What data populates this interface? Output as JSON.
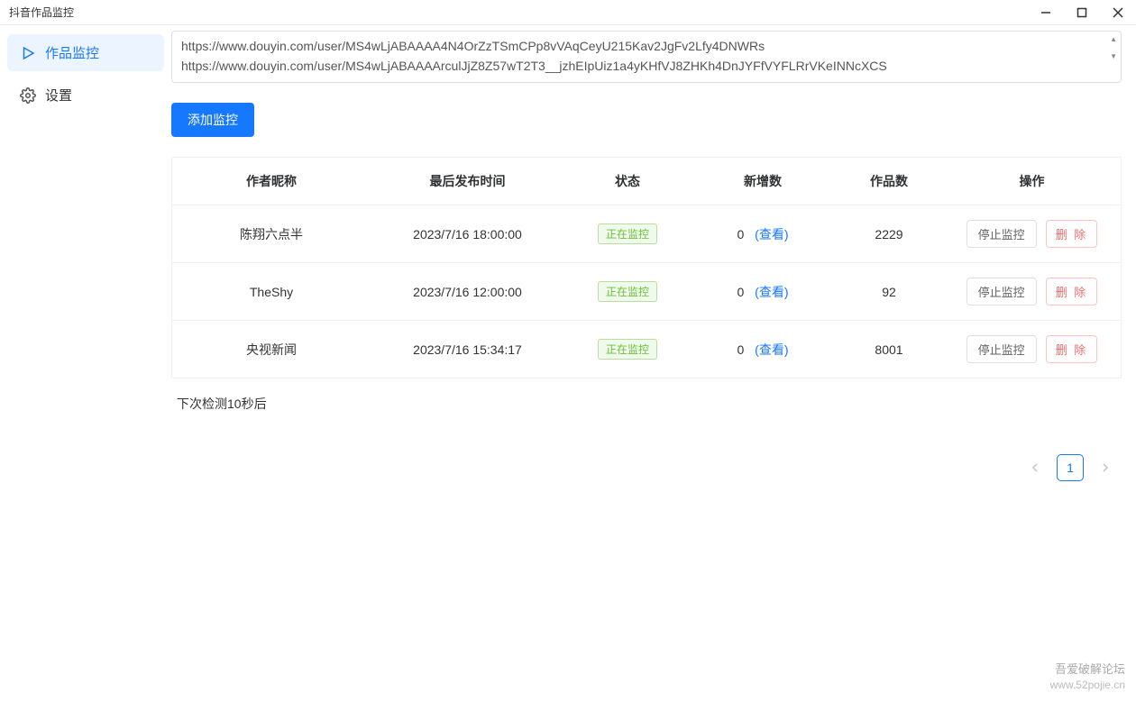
{
  "window": {
    "title": "抖音作品监控"
  },
  "sidebar": {
    "items": [
      {
        "label": "作品监控",
        "active": true
      },
      {
        "label": "设置",
        "active": false
      }
    ]
  },
  "urls_text": "https://www.douyin.com/user/MS4wLjABAAAA4N4OrZzTSmCPp8vVAqCeyU215Kav2JgFv2Lfy4DNWRs\nhttps://www.douyin.com/user/MS4wLjABAAAArculJjZ8Z57wT2T3__jzhEIpUiz1a4yKHfVJ8ZHKh4DnJYFfVYFLRrVKeINNcXCS",
  "add_button_label": "添加监控",
  "table": {
    "headers": {
      "name": "作者昵称",
      "time": "最后发布时间",
      "status": "状态",
      "new": "新增数",
      "works": "作品数",
      "ops": "操作"
    },
    "status_label": "正在监控",
    "view_label": "(查看)",
    "stop_label": "停止监控",
    "delete_label": "删 除",
    "rows": [
      {
        "name": "陈翔六点半",
        "time": "2023/7/16 18:00:00",
        "new": "0",
        "works": "2229"
      },
      {
        "name": "TheShy",
        "time": "2023/7/16 12:00:00",
        "new": "0",
        "works": "92"
      },
      {
        "name": "央视新闻",
        "time": "2023/7/16 15:34:17",
        "new": "0",
        "works": "8001"
      }
    ]
  },
  "next_check": "下次检测10秒后",
  "pager": {
    "current": "1"
  },
  "watermark": {
    "line1": "吾爱破解论坛",
    "line2": "www.52pojie.cn"
  }
}
